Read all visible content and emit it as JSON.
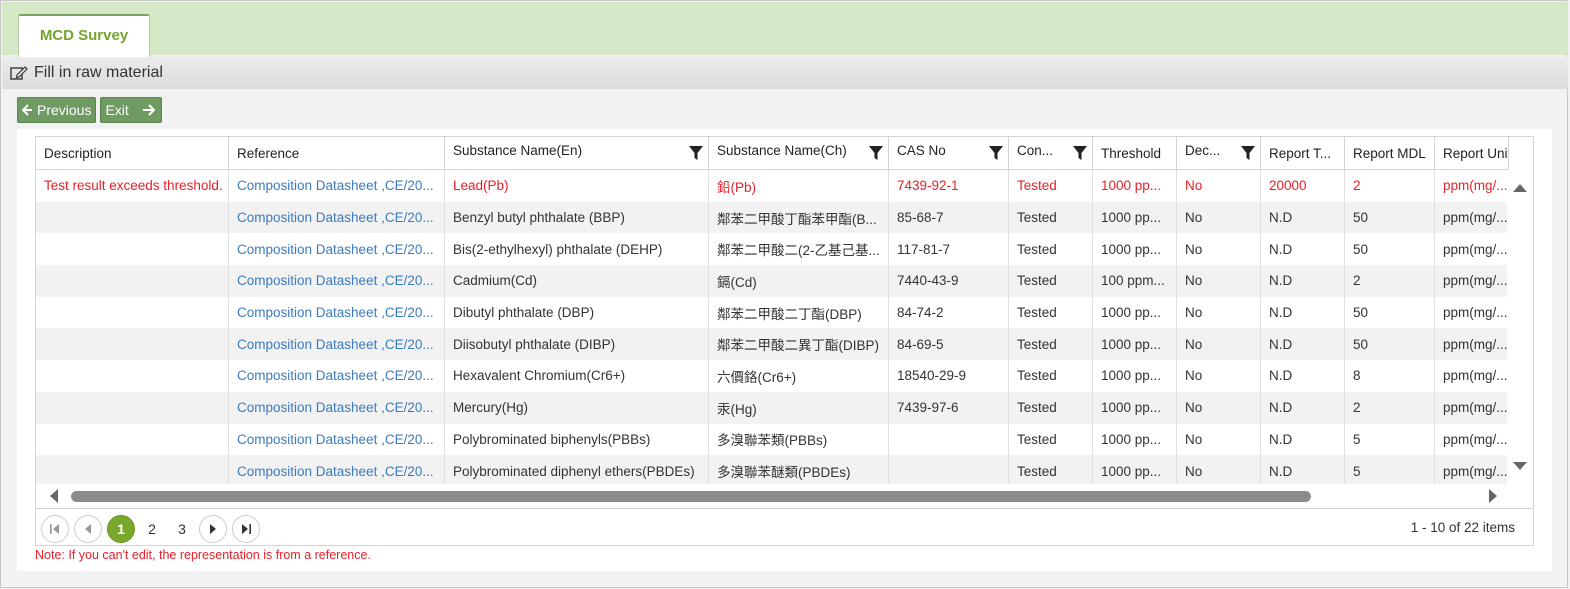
{
  "tabs": [
    {
      "label": "MCD Survey"
    }
  ],
  "section": {
    "title": "Fill in raw material"
  },
  "buttons": {
    "previous": "Previous",
    "exit": "Exit"
  },
  "grid": {
    "columns": [
      {
        "label": "Description",
        "filter": false
      },
      {
        "label": "Reference",
        "filter": false
      },
      {
        "label": "Substance Name(En)",
        "filter": true
      },
      {
        "label": "Substance Name(Ch)",
        "filter": true
      },
      {
        "label": "CAS No",
        "filter": true
      },
      {
        "label": "Con...",
        "filter": true
      },
      {
        "label": "Threshold",
        "filter": false
      },
      {
        "label": "Dec...",
        "filter": true
      },
      {
        "label": "Report T...",
        "filter": false
      },
      {
        "label": "Report MDL",
        "filter": false
      },
      {
        "label": "Report Unit",
        "filter": false
      }
    ],
    "rows": [
      {
        "error": true,
        "cells": [
          "Test result exceeds threshold.",
          "Composition Datasheet ,CE/20...",
          "Lead(Pb)",
          "鉛(Pb)",
          "7439-92-1",
          "Tested",
          "1000 pp...",
          "No",
          "20000",
          "2",
          "ppm(mg/..."
        ]
      },
      {
        "error": false,
        "cells": [
          "",
          "Composition Datasheet ,CE/20...",
          "Benzyl butyl phthalate (BBP)",
          "鄰苯二甲酸丁酯苯甲酯(B...",
          "85-68-7",
          "Tested",
          "1000 pp...",
          "No",
          "N.D",
          "50",
          "ppm(mg/..."
        ]
      },
      {
        "error": false,
        "cells": [
          "",
          "Composition Datasheet ,CE/20...",
          "Bis(2-ethylhexyl) phthalate (DEHP)",
          "鄰苯二甲酸二(2-乙基己基...",
          "117-81-7",
          "Tested",
          "1000 pp...",
          "No",
          "N.D",
          "50",
          "ppm(mg/..."
        ]
      },
      {
        "error": false,
        "cells": [
          "",
          "Composition Datasheet ,CE/20...",
          "Cadmium(Cd)",
          "鎘(Cd)",
          "7440-43-9",
          "Tested",
          "100 ppm...",
          "No",
          "N.D",
          "2",
          "ppm(mg/..."
        ]
      },
      {
        "error": false,
        "cells": [
          "",
          "Composition Datasheet ,CE/20...",
          "Dibutyl phthalate (DBP)",
          "鄰苯二甲酸二丁酯(DBP)",
          "84-74-2",
          "Tested",
          "1000 pp...",
          "No",
          "N.D",
          "50",
          "ppm(mg/..."
        ]
      },
      {
        "error": false,
        "cells": [
          "",
          "Composition Datasheet ,CE/20...",
          "Diisobutyl phthalate (DIBP)",
          "鄰苯二甲酸二異丁酯(DIBP)",
          "84-69-5",
          "Tested",
          "1000 pp...",
          "No",
          "N.D",
          "50",
          "ppm(mg/..."
        ]
      },
      {
        "error": false,
        "cells": [
          "",
          "Composition Datasheet ,CE/20...",
          "Hexavalent Chromium(Cr6+)",
          "六價鉻(Cr6+)",
          "18540-29-9",
          "Tested",
          "1000 pp...",
          "No",
          "N.D",
          "8",
          "ppm(mg/..."
        ]
      },
      {
        "error": false,
        "cells": [
          "",
          "Composition Datasheet ,CE/20...",
          "Mercury(Hg)",
          "汞(Hg)",
          "7439-97-6",
          "Tested",
          "1000 pp...",
          "No",
          "N.D",
          "2",
          "ppm(mg/..."
        ]
      },
      {
        "error": false,
        "cells": [
          "",
          "Composition Datasheet ,CE/20...",
          "Polybrominated biphenyls(PBBs)",
          "多溴聯苯類(PBBs)",
          "",
          "Tested",
          "1000 pp...",
          "No",
          "N.D",
          "5",
          "ppm(mg/..."
        ]
      },
      {
        "error": false,
        "cells": [
          "",
          "Composition Datasheet ,CE/20...",
          "Polybrominated diphenyl ethers(PBDEs)",
          "多溴聯苯醚類(PBDEs)",
          "",
          "Tested",
          "1000 pp...",
          "No",
          "N.D",
          "5",
          "ppm(mg/..."
        ]
      }
    ]
  },
  "pager": {
    "pages": [
      "1",
      "2",
      "3"
    ],
    "current": "1",
    "info": "1 - 10 of 22 items"
  },
  "note": "Note: If you can't edit, the representation is from a reference.",
  "colors": {
    "accent": "#7aa82c",
    "tab_bg": "#d4e8c6",
    "button": "#6f9a62",
    "error": "#e8202a",
    "link": "#3b7bbf"
  },
  "icons": {
    "section": "edit-icon",
    "previous": "arrow-left-icon",
    "exit": "arrow-right-icon",
    "filter": "filter-icon"
  }
}
